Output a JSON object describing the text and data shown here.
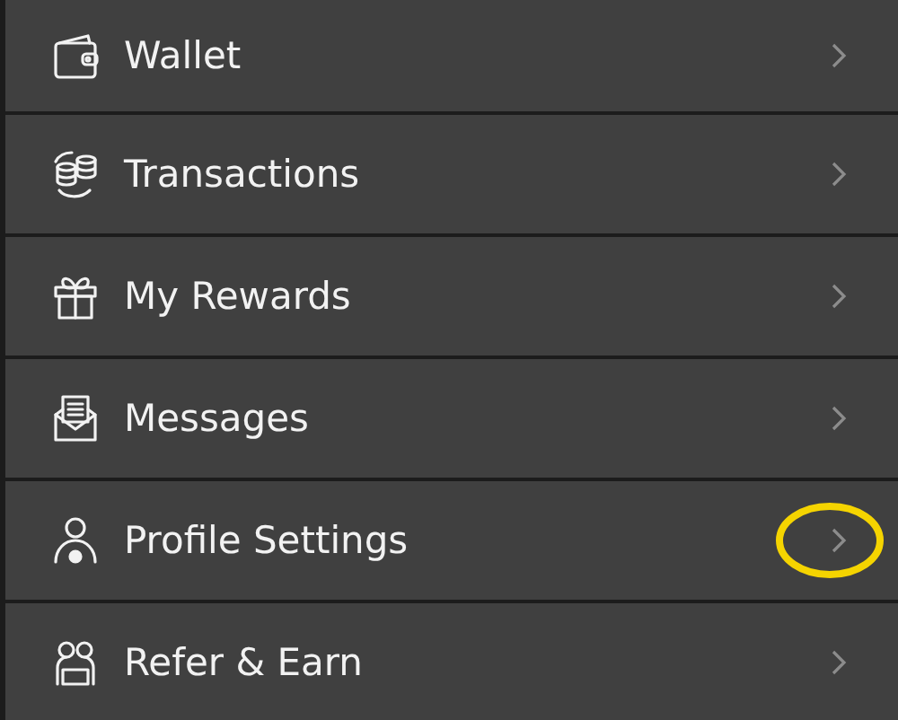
{
  "menu": {
    "items": [
      {
        "label": "Wallet",
        "highlighted": false
      },
      {
        "label": "Transactions",
        "highlighted": false
      },
      {
        "label": "My Rewards",
        "highlighted": false
      },
      {
        "label": "Messages",
        "highlighted": false
      },
      {
        "label": "Profile Settings",
        "highlighted": true
      },
      {
        "label": "Refer & Earn",
        "highlighted": false
      }
    ]
  }
}
